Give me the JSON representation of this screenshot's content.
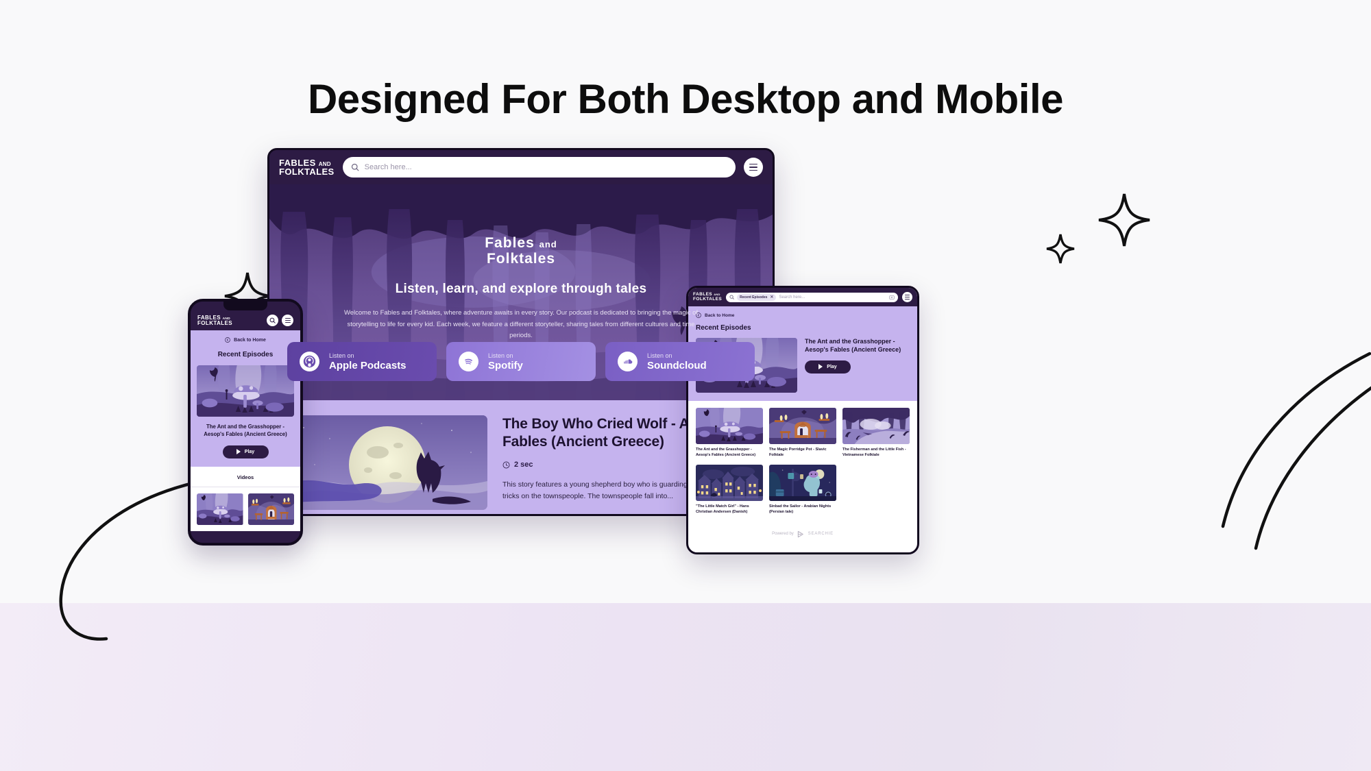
{
  "page": {
    "title": "Designed For Both Desktop and Mobile",
    "background_top": "#f9f9fa",
    "background_bottom": "#efe7f4"
  },
  "brand": {
    "name_line1": "Fables",
    "name_and": "and",
    "name_line2": "Folktales",
    "accent_dark": "#2d1b44",
    "accent_lavender": "#c5b3ee",
    "accent_purple": "#6a4cae"
  },
  "desktop": {
    "search": {
      "placeholder": "Search here...",
      "icon": "search-icon"
    },
    "menu_icon": "hamburger-icon",
    "hero": {
      "logo_line1": "Fables",
      "logo_and": "and",
      "logo_line2": "Folktales",
      "tagline": "Listen, learn, and explore through tales",
      "description": "Welcome to Fables and Folktales, where adventure awaits in every story. Our podcast is dedicated to bringing the magic of storytelling to life for every kid. Each week, we feature a different storyteller, sharing tales from different cultures and time periods."
    },
    "listen_buttons": [
      {
        "small": "Listen on",
        "big": "Apple Podcasts",
        "icon": "apple-podcasts-icon",
        "color": "#6a4cae"
      },
      {
        "small": "Listen on",
        "big": "Spotify",
        "icon": "spotify-icon",
        "color": "#a490e3"
      },
      {
        "small": "Listen on",
        "big": "Soundcloud",
        "icon": "soundcloud-icon",
        "color": "#8b72d2"
      }
    ],
    "featured_episode": {
      "title": "The Boy Who Cried Wolf - Aesop's Fables (Ancient Greece)",
      "duration": "2 sec",
      "duration_icon": "clock-icon",
      "description": "This story features a young shepherd boy who is guarding his flock and playing tricks on the townspeople. The townspeople fall into..."
    }
  },
  "tablet": {
    "search": {
      "placeholder": "Search here...",
      "chip_label": "Recent Episodes",
      "chip_remove_icon": "close-icon",
      "icon": "search-icon",
      "clear_icon": "clear-input-icon"
    },
    "menu_icon": "hamburger-icon",
    "back_label": "Back to Home",
    "back_icon": "back-circle-icon",
    "section_title": "Recent Episodes",
    "featured": {
      "title": "The Ant and the Grasshopper - Aesop's Fables (Ancient Greece)",
      "play_label": "Play",
      "play_icon": "play-icon"
    },
    "cards": [
      {
        "caption": "The Ant and the Grasshopper - Aesop's Fables (Ancient Greece)",
        "art": "mushroom"
      },
      {
        "caption": "The Magic Porridge Pot - Slavic Folktale",
        "art": "cottage"
      },
      {
        "caption": "The Fisherman and the Little Fish - Vietnamese Folktale",
        "art": "river"
      },
      {
        "caption": "\"The Little Match Girl\" - Hans Christian Andersen (Danish)",
        "art": "town"
      },
      {
        "caption": "Sinbad the Sailor - Arabian Nights (Persian tale)",
        "art": "ship"
      }
    ],
    "footer": {
      "powered_by": "Powered by",
      "brand": "SEARCHIE",
      "icon": "searchie-logo-icon"
    }
  },
  "mobile": {
    "search_icon": "search-icon",
    "menu_icon": "hamburger-icon",
    "back_label": "Back to Home",
    "back_icon": "back-circle-icon",
    "section_title": "Recent Episodes",
    "featured": {
      "title": "The Ant and the Grasshopper - Aesop's Fables (Ancient Greece)",
      "play_label": "Play",
      "play_icon": "play-icon"
    },
    "tab_label": "Videos",
    "cards": [
      {
        "art": "mushroom"
      },
      {
        "art": "cottage"
      }
    ]
  }
}
